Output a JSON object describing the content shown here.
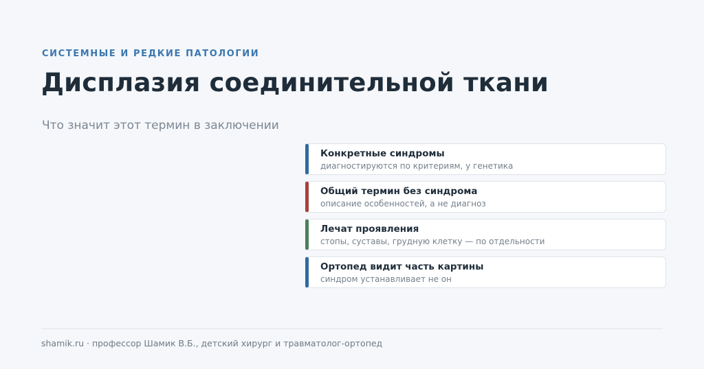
{
  "header": {
    "eyebrow": "СИСТЕМНЫЕ И РЕДКИЕ ПАТОЛОГИИ",
    "title": "Дисплазия соединительной ткани",
    "subtitle": "Что значит этот термин в заключении"
  },
  "cards": [
    {
      "title": "Конкретные синдромы",
      "description": "диагностируются по критериям, у генетика",
      "accent_color": "#2f6aa3"
    },
    {
      "title": "Общий термин без синдрома",
      "description": "описание особенностей, а не диагноз",
      "accent_color": "#a8403c"
    },
    {
      "title": "Лечат проявления",
      "description": "стопы, суставы, грудную клетку — по отдельности",
      "accent_color": "#4a7e5c"
    },
    {
      "title": "Ортопед видит часть картины",
      "description": "синдром устанавливает не он",
      "accent_color": "#2f6aa3"
    }
  ],
  "footer": {
    "text": "shamik.ru · профессор Шамик В.Б., детский хирург и травматолог-ортопед"
  }
}
